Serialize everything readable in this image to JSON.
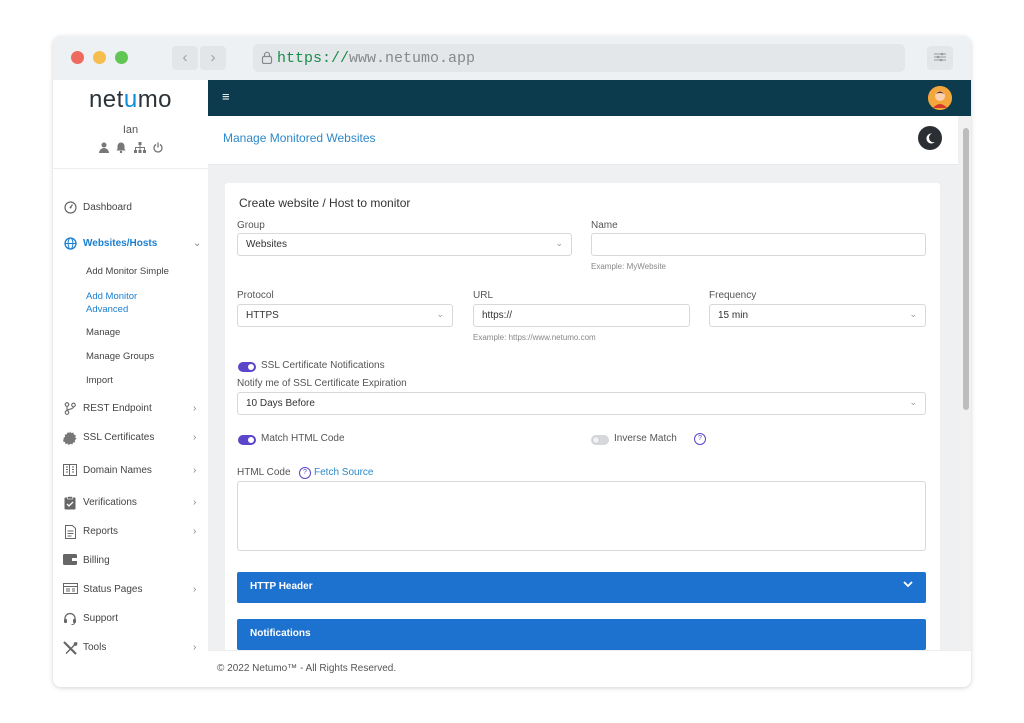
{
  "browser": {
    "url_scheme": "https://",
    "url_host": "www.netumo.app",
    "back_glyph": "‹",
    "forward_glyph": "›"
  },
  "colors": {
    "topbar": "#0c3b4d",
    "accent_blue": "#1d72cf",
    "link_blue": "#2d89c8",
    "toggle_purple": "#5b45c9"
  },
  "sidebar": {
    "logo_start": "net",
    "logo_u": "u",
    "logo_end": "mo",
    "user_name": "Ian",
    "user_icons": [
      "user-icon",
      "bell-icon",
      "sitemap-icon",
      "power-icon"
    ],
    "items": [
      {
        "label": "Dashboard",
        "icon": "dashboard-icon"
      },
      {
        "label": "Websites/Hosts",
        "icon": "globe-icon",
        "chev": "⌄"
      },
      {
        "label": "REST Endpoint",
        "icon": "branch-icon",
        "chev": "›"
      },
      {
        "label": "SSL Certificates",
        "icon": "certificate-icon",
        "chev": "›"
      },
      {
        "label": "Domain Names",
        "icon": "building-icon",
        "chev": "›"
      },
      {
        "label": "Verifications",
        "icon": "clipboard-check-icon",
        "chev": "›"
      },
      {
        "label": "Reports",
        "icon": "document-icon",
        "chev": "›"
      },
      {
        "label": "Billing",
        "icon": "wallet-icon"
      },
      {
        "label": "Status Pages",
        "icon": "status-pages-icon",
        "chev": "›"
      },
      {
        "label": "Support",
        "icon": "headset-icon"
      },
      {
        "label": "Tools",
        "icon": "tools-icon",
        "chev": "›"
      }
    ],
    "subitems": [
      {
        "label": "Add Monitor Simple"
      },
      {
        "label": "Add Monitor Advanced"
      },
      {
        "label": "Manage"
      },
      {
        "label": "Manage Groups"
      },
      {
        "label": "Import"
      }
    ]
  },
  "topbar": {
    "menu_glyph": "≡"
  },
  "page": {
    "title": "Manage Monitored Websites"
  },
  "form": {
    "title": "Create website / Host to monitor",
    "group": {
      "label": "Group",
      "value": "Websites"
    },
    "name": {
      "label": "Name",
      "value": "",
      "hint": "Example: MyWebsite"
    },
    "protocol": {
      "label": "Protocol",
      "value": "HTTPS"
    },
    "url": {
      "label": "URL",
      "value": "https://",
      "hint": "Example: https://www.netumo.com"
    },
    "frequency": {
      "label": "Frequency",
      "value": "15 min"
    },
    "ssl_notifications": {
      "label": "SSL Certificate Notifications",
      "on": true
    },
    "ssl_expiration": {
      "label": "Notify me of SSL Certificate Expiration",
      "value": "10 Days Before"
    },
    "match_html": {
      "label": "Match HTML Code",
      "on": true
    },
    "inverse_match": {
      "label": "Inverse Match",
      "on": false
    },
    "html_code": {
      "label": "HTML Code",
      "fetch_label": "Fetch Source"
    },
    "help_glyph": "?",
    "dropdown_glyph": "⌄",
    "sections": [
      {
        "label": "HTTP Header",
        "chev": "⌄"
      },
      {
        "label": "Notifications"
      }
    ]
  },
  "footer": {
    "text": "© 2022 Netumo™ - All Rights Reserved."
  }
}
